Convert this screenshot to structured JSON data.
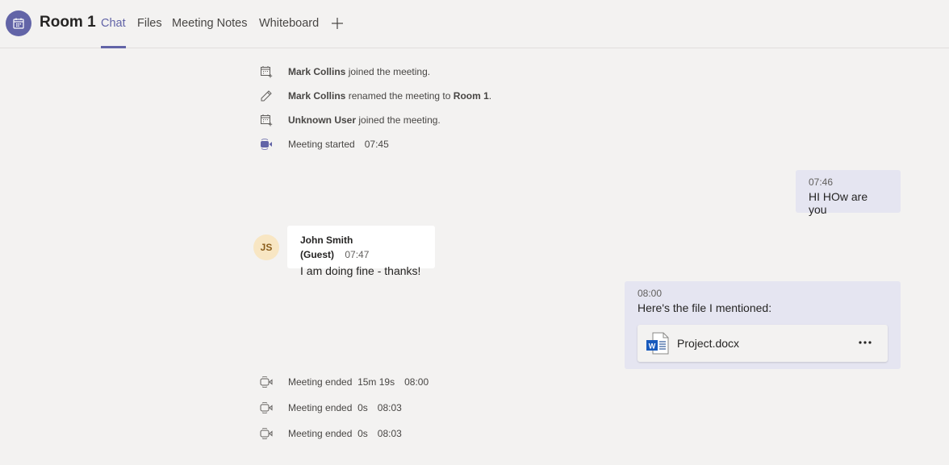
{
  "header": {
    "room_title": "Room 1",
    "tabs": [
      {
        "label": "Chat",
        "active": true
      },
      {
        "label": "Files",
        "active": false
      },
      {
        "label": "Meeting Notes",
        "active": false
      },
      {
        "label": "Whiteboard",
        "active": false
      }
    ],
    "add_tab_icon": "plus-icon",
    "meeting_icon": "calendar-icon"
  },
  "events_top": [
    {
      "icon": "calendar-add-icon",
      "actor": "Mark Collins",
      "text": " joined the meeting."
    },
    {
      "icon": "pencil-icon",
      "actor": "Mark Collins",
      "text": " renamed the meeting to ",
      "target": "Room 1",
      "suffix": "."
    },
    {
      "icon": "calendar-add-icon",
      "actor": "Unknown User",
      "text": " joined the meeting."
    },
    {
      "icon": "video-camera-icon",
      "text": "Meeting started",
      "time": "07:45"
    }
  ],
  "messages": [
    {
      "from": "me",
      "time": "07:46",
      "text": "HI HOw are you"
    },
    {
      "from": "them",
      "sender": "John Smith (Guest)",
      "initials": "JS",
      "time": "07:47",
      "text": "I am doing fine - thanks!"
    },
    {
      "from": "me",
      "time": "08:00",
      "text": "Here's the file I mentioned:",
      "attachment": {
        "name": "Project.docx",
        "icon": "word-document-icon"
      }
    }
  ],
  "events_bottom": [
    {
      "icon": "video-camera-off-icon",
      "text": "Meeting ended",
      "duration": "15m 19s",
      "time": "08:00"
    },
    {
      "icon": "video-camera-off-icon",
      "text": "Meeting ended",
      "duration": "0s",
      "time": "08:03"
    },
    {
      "icon": "video-camera-off-icon",
      "text": "Meeting ended",
      "duration": "0s",
      "time": "08:03"
    }
  ],
  "colors": {
    "accent": "#6264a7",
    "my_bubble": "#e5e5f1",
    "background": "#f3f2f1"
  }
}
